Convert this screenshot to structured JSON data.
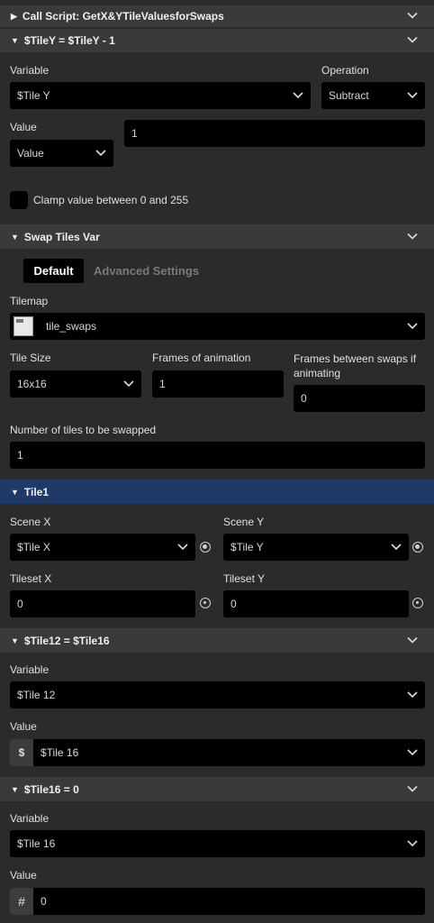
{
  "call_script": {
    "title": "Call Script: GetX&YTileValuesforSwaps"
  },
  "tiley": {
    "title": "$TileY = $TileY - 1",
    "variable_label": "Variable",
    "variable_value": "$Tile Y",
    "operation_label": "Operation",
    "operation_value": "Subtract",
    "value_label": "Value",
    "value_type": "Value",
    "value_number": "1",
    "clamp_label": "Clamp value between 0 and 255"
  },
  "swap": {
    "title": "Swap Tiles Var",
    "tab_default": "Default",
    "tab_advanced": "Advanced Settings",
    "tilemap_label": "Tilemap",
    "tilemap_value": "tile_swaps",
    "tile_size_label": "Tile Size",
    "tile_size_value": "16x16",
    "frames_label": "Frames of animation",
    "frames_value": "1",
    "frames_between_label": "Frames between swaps if animating",
    "frames_between_value": "0",
    "num_tiles_label": "Number of tiles to be swapped",
    "num_tiles_value": "1"
  },
  "tile1": {
    "title": "Tile1",
    "scene_x_label": "Scene X",
    "scene_x_value": "$Tile X",
    "scene_y_label": "Scene Y",
    "scene_y_value": "$Tile Y",
    "tileset_x_label": "Tileset X",
    "tileset_x_value": "0",
    "tileset_y_label": "Tileset Y",
    "tileset_y_value": "0"
  },
  "tile12": {
    "title": "$Tile12 = $Tile16",
    "variable_label": "Variable",
    "variable_value": "$Tile 12",
    "value_label": "Value",
    "value_prefix": "$",
    "value_value": "$Tile 16"
  },
  "tile16": {
    "title": "$Tile16 = 0",
    "variable_label": "Variable",
    "variable_value": "$Tile 16",
    "value_label": "Value",
    "value_prefix": "#",
    "value_value": "0"
  },
  "icons": {
    "expanded": "caret-down-icon",
    "collapsed": "caret-right-icon",
    "chevron": "chevron-down-icon",
    "radio": "radio-target-icon"
  },
  "colors": {
    "background": "#2b2b2b",
    "header": "#3a3a3a",
    "active_header": "#1f3a66",
    "field": "#000000"
  }
}
